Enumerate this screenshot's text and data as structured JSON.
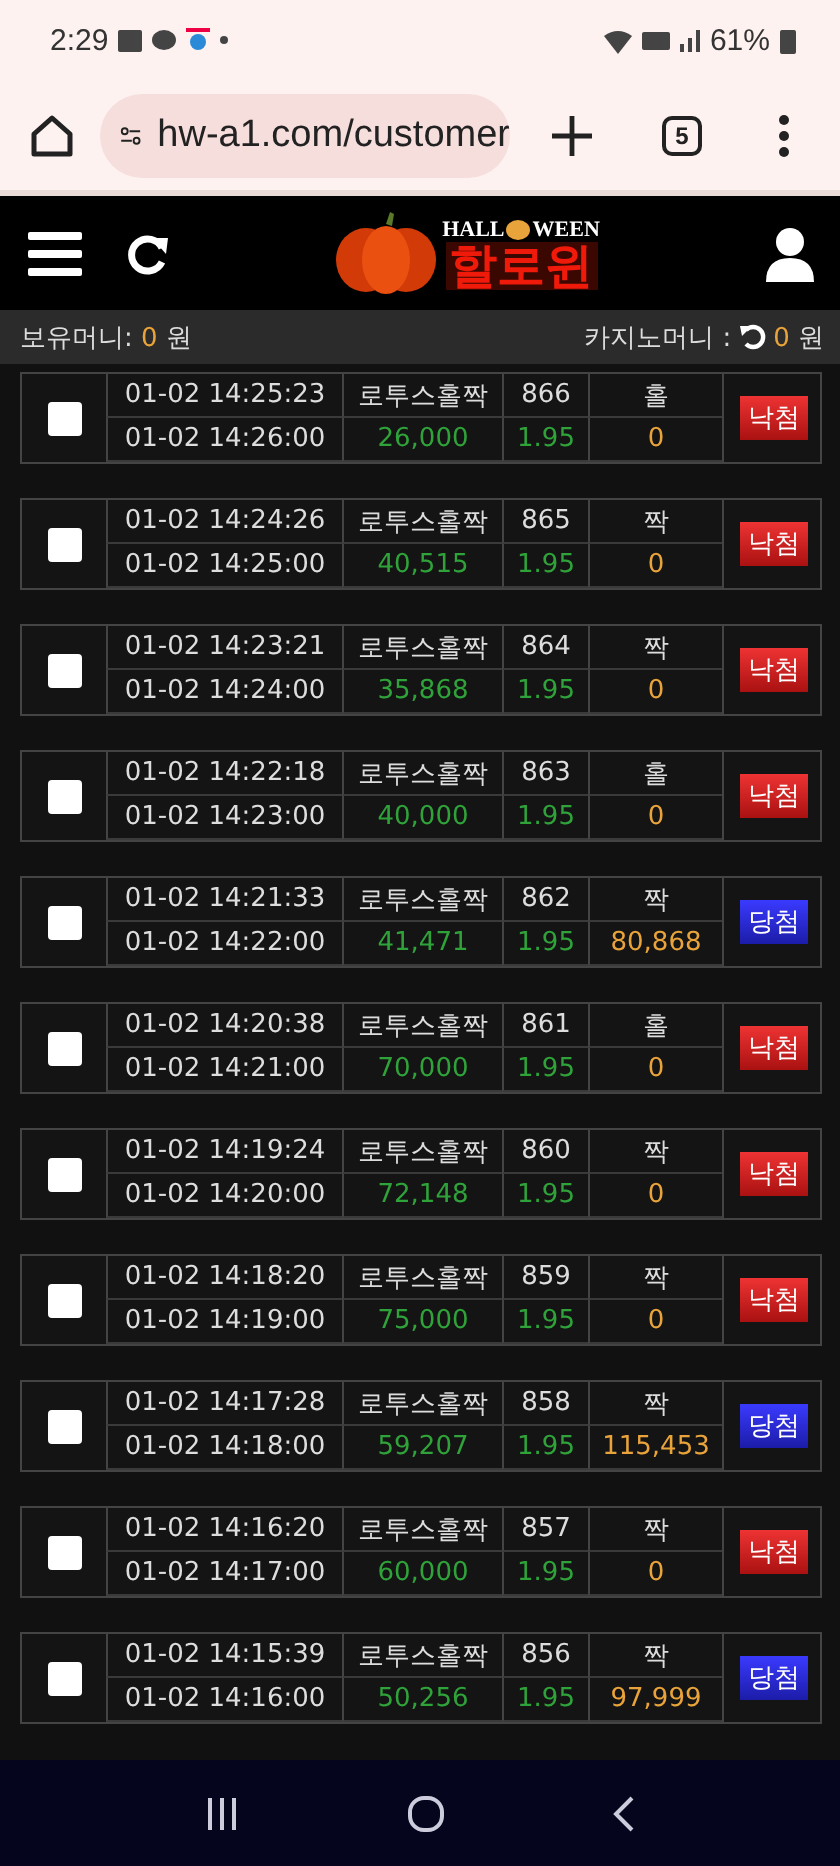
{
  "status_bar": {
    "time": "2:29",
    "battery": "61%"
  },
  "browser": {
    "url": "hw-a1.com/customer",
    "tab_count": "5"
  },
  "logo": {
    "top_left": "HALL",
    "top_right": "WEEN",
    "title": "할로윈"
  },
  "balance": {
    "label": "보유머니:",
    "amount": "0",
    "unit": "원",
    "casino_label": "카지노머니 :",
    "casino_amount": "0",
    "casino_unit": "원"
  },
  "bets": [
    {
      "checked": false,
      "placed": "01-02 14:25:23",
      "closes": "01-02 14:26:00",
      "game": "로투스홀짝",
      "round": "866",
      "pick": "홀",
      "stake": "26,000",
      "odds": "1.95",
      "payout": "0",
      "result": {
        "kind": "lose",
        "label": "낙첨"
      }
    },
    {
      "checked": false,
      "placed": "01-02 14:24:26",
      "closes": "01-02 14:25:00",
      "game": "로투스홀짝",
      "round": "865",
      "pick": "짝",
      "stake": "40,515",
      "odds": "1.95",
      "payout": "0",
      "result": {
        "kind": "lose",
        "label": "낙첨"
      }
    },
    {
      "checked": false,
      "placed": "01-02 14:23:21",
      "closes": "01-02 14:24:00",
      "game": "로투스홀짝",
      "round": "864",
      "pick": "짝",
      "stake": "35,868",
      "odds": "1.95",
      "payout": "0",
      "result": {
        "kind": "lose",
        "label": "낙첨"
      }
    },
    {
      "checked": false,
      "placed": "01-02 14:22:18",
      "closes": "01-02 14:23:00",
      "game": "로투스홀짝",
      "round": "863",
      "pick": "홀",
      "stake": "40,000",
      "odds": "1.95",
      "payout": "0",
      "result": {
        "kind": "lose",
        "label": "낙첨"
      }
    },
    {
      "checked": false,
      "placed": "01-02 14:21:33",
      "closes": "01-02 14:22:00",
      "game": "로투스홀짝",
      "round": "862",
      "pick": "짝",
      "stake": "41,471",
      "odds": "1.95",
      "payout": "80,868",
      "result": {
        "kind": "win",
        "label": "당첨"
      }
    },
    {
      "checked": false,
      "placed": "01-02 14:20:38",
      "closes": "01-02 14:21:00",
      "game": "로투스홀짝",
      "round": "861",
      "pick": "홀",
      "stake": "70,000",
      "odds": "1.95",
      "payout": "0",
      "result": {
        "kind": "lose",
        "label": "낙첨"
      }
    },
    {
      "checked": false,
      "placed": "01-02 14:19:24",
      "closes": "01-02 14:20:00",
      "game": "로투스홀짝",
      "round": "860",
      "pick": "짝",
      "stake": "72,148",
      "odds": "1.95",
      "payout": "0",
      "result": {
        "kind": "lose",
        "label": "낙첨"
      }
    },
    {
      "checked": false,
      "placed": "01-02 14:18:20",
      "closes": "01-02 14:19:00",
      "game": "로투스홀짝",
      "round": "859",
      "pick": "짝",
      "stake": "75,000",
      "odds": "1.95",
      "payout": "0",
      "result": {
        "kind": "lose",
        "label": "낙첨"
      }
    },
    {
      "checked": false,
      "placed": "01-02 14:17:28",
      "closes": "01-02 14:18:00",
      "game": "로투스홀짝",
      "round": "858",
      "pick": "짝",
      "stake": "59,207",
      "odds": "1.95",
      "payout": "115,453",
      "result": {
        "kind": "win",
        "label": "당첨"
      }
    },
    {
      "checked": false,
      "placed": "01-02 14:16:20",
      "closes": "01-02 14:17:00",
      "game": "로투스홀짝",
      "round": "857",
      "pick": "짝",
      "stake": "60,000",
      "odds": "1.95",
      "payout": "0",
      "result": {
        "kind": "lose",
        "label": "낙첨"
      }
    },
    {
      "checked": false,
      "placed": "01-02 14:15:39",
      "closes": "01-02 14:16:00",
      "game": "로투스홀짝",
      "round": "856",
      "pick": "짝",
      "stake": "50,256",
      "odds": "1.95",
      "payout": "97,999",
      "result": {
        "kind": "win",
        "label": "당첨"
      }
    }
  ]
}
